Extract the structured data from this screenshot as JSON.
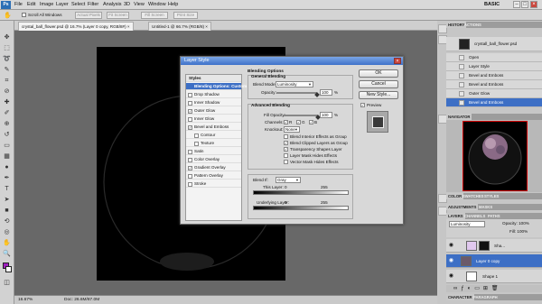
{
  "app": {
    "logo": "Ps",
    "workspace": "BASIC",
    "window_min": "–",
    "window_max": "□",
    "window_close": "×"
  },
  "menu": [
    "File",
    "Edit",
    "Image",
    "Layer",
    "Select",
    "Filter",
    "Analysis",
    "3D",
    "View",
    "Window",
    "Help"
  ],
  "options": {
    "scroll_all": "Scroll All Windows",
    "actual_pixels": "Actual Pixels",
    "fit_screen": "Fit Screen",
    "fill_screen": "Fill Screen",
    "print_size": "Print Size"
  },
  "doc_tabs": [
    "crystal_ball_flower.psd @ 16.7% (Layer 0 copy, RGB/8#) ×",
    "Untitled-1 @ 66.7% (RGB/8) ×"
  ],
  "status": {
    "zoom": "16.67%",
    "doc": "Doc: 26.6M/87.0M"
  },
  "history": {
    "tabs": [
      "HISTORY",
      "ACTIONS"
    ],
    "snapshot": "crystall_ball_flower.psd",
    "items": [
      "Open",
      "Layer Style",
      "Bevel and Emboss",
      "Bevel and Emboss",
      "Outer Glow",
      "Bevel and Emboss"
    ],
    "selected_index": 5
  },
  "navigator": {
    "tab": "NAVIGATOR"
  },
  "color_tabs": [
    "COLOR",
    "SWATCHES",
    "STYLES"
  ],
  "adj_tabs": [
    "ADJUSTMENTS",
    "MASKS"
  ],
  "layers": {
    "tabs": [
      "LAYERS",
      "CHANNELS",
      "PATHS"
    ],
    "blend": "Luminosity",
    "opacity": "Opacity: 100%",
    "fill": "Fill: 100%",
    "rows": [
      {
        "name": "Sha...",
        "selected": false
      },
      {
        "name": "Layer 0 copy",
        "selected": true
      },
      {
        "name": "Shape 1",
        "selected": false
      }
    ]
  },
  "character_tabs": [
    "CHARACTER",
    "PARAGRAPH"
  ],
  "dialog": {
    "title": "Layer Style",
    "close": "×",
    "styles_header": "Styles",
    "style_items": [
      {
        "label": "Blending Options: Custom",
        "checkbox": false,
        "checked": false,
        "selected": true,
        "indent": false
      },
      {
        "label": "Drop Shadow",
        "checkbox": true,
        "checked": false,
        "selected": false,
        "indent": false
      },
      {
        "label": "Inner Shadow",
        "checkbox": true,
        "checked": false,
        "selected": false,
        "indent": false
      },
      {
        "label": "Outer Glow",
        "checkbox": true,
        "checked": true,
        "selected": false,
        "indent": false
      },
      {
        "label": "Inner Glow",
        "checkbox": true,
        "checked": false,
        "selected": false,
        "indent": false
      },
      {
        "label": "Bevel and Emboss",
        "checkbox": true,
        "checked": true,
        "selected": false,
        "indent": false
      },
      {
        "label": "Contour",
        "checkbox": true,
        "checked": false,
        "selected": false,
        "indent": true
      },
      {
        "label": "Texture",
        "checkbox": true,
        "checked": false,
        "selected": false,
        "indent": true
      },
      {
        "label": "Satin",
        "checkbox": true,
        "checked": false,
        "selected": false,
        "indent": false
      },
      {
        "label": "Color Overlay",
        "checkbox": true,
        "checked": false,
        "selected": false,
        "indent": false
      },
      {
        "label": "Gradient Overlay",
        "checkbox": true,
        "checked": true,
        "selected": false,
        "indent": false
      },
      {
        "label": "Pattern Overlay",
        "checkbox": true,
        "checked": false,
        "selected": false,
        "indent": false
      },
      {
        "label": "Stroke",
        "checkbox": true,
        "checked": false,
        "selected": false,
        "indent": false
      }
    ],
    "blending_options": "Blending Options",
    "general_blending": "General Blending",
    "blend_mode_label": "Blend Mode:",
    "blend_mode": "Luminosity",
    "opacity_label": "Opacity:",
    "opacity": "100",
    "opacity_level": 1.0,
    "fill_opacity_level": 1.0,
    "percent": "%",
    "advanced_blending": "Advanced Blending",
    "fill_opacity_label": "Fill Opacity:",
    "fill_opacity": "100",
    "channels_label": "Channels:",
    "channels": [
      "R",
      "G",
      "B"
    ],
    "knockout_label": "Knockout:",
    "knockout": "None",
    "adv_checks": [
      {
        "label": "Blend Interior Effects as Group",
        "checked": false
      },
      {
        "label": "Blend Clipped Layers as Group",
        "checked": true
      },
      {
        "label": "Transparency Shapes Layer",
        "checked": true
      },
      {
        "label": "Layer Mask Hides Effects",
        "checked": false
      },
      {
        "label": "Vector Mask Hides Effects",
        "checked": false
      }
    ],
    "blend_if_label": "Blend If:",
    "blend_if": "Gray",
    "this_layer": "This Layer:",
    "underlying_layer": "Underlying Layer:",
    "range_min": "0",
    "range_max": "255",
    "ok": "OK",
    "cancel": "Cancel",
    "new_style": "New Style...",
    "preview": "Preview"
  }
}
